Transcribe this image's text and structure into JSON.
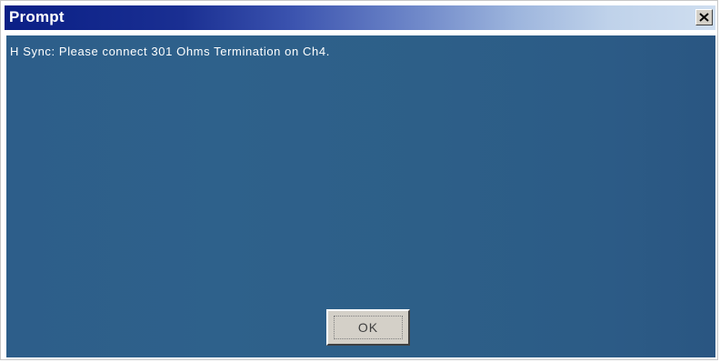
{
  "window": {
    "title": "Prompt",
    "close_icon": "close-icon"
  },
  "content": {
    "message": "H Sync: Please connect 301 Ohms Termination on Ch4."
  },
  "buttons": {
    "ok_label": "OK"
  },
  "colors": {
    "titlebar_start": "#0a1f86",
    "titlebar_end": "#cfdef0",
    "content_background": "#2e618b",
    "message_text": "#ffffff",
    "button_face": "#d4d0c8"
  }
}
